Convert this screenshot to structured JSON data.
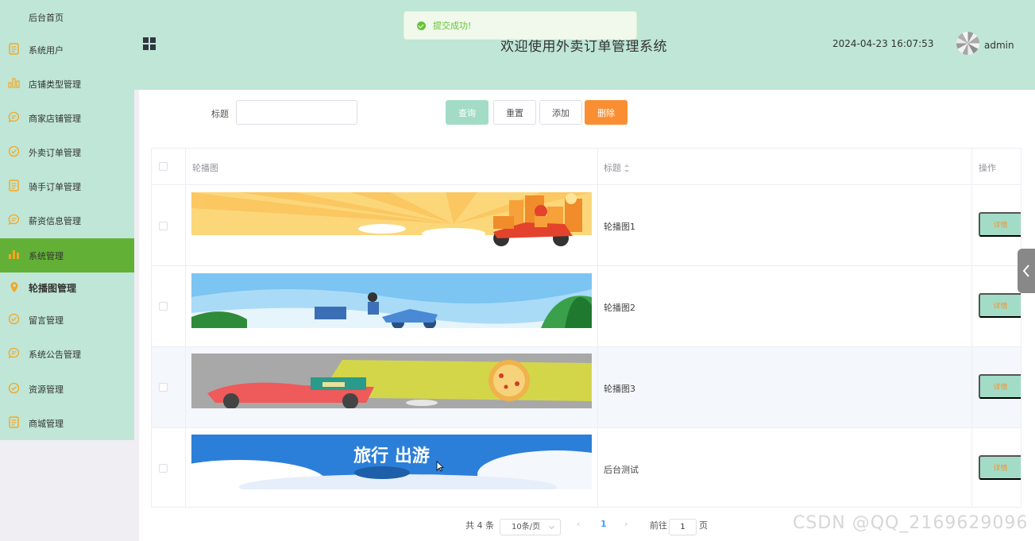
{
  "sidebar": {
    "items": [
      {
        "label": "后台首页",
        "icon": "none"
      },
      {
        "label": "系统用户",
        "icon": "document-icon"
      },
      {
        "label": "店铺类型管理",
        "icon": "bar-chart-icon"
      },
      {
        "label": "商家店铺管理",
        "icon": "chat-bubble-icon"
      },
      {
        "label": "外卖订单管理",
        "icon": "check-circle-icon"
      },
      {
        "label": "骑手订单管理",
        "icon": "document-icon"
      },
      {
        "label": "薪资信息管理",
        "icon": "chat-bubble-icon"
      },
      {
        "label": "系统管理",
        "icon": "bar-chart-icon",
        "active": true
      },
      {
        "label": "轮播图管理",
        "icon": "location-pin-icon",
        "sub": true
      },
      {
        "label": "留言管理",
        "icon": "check-circle-icon"
      },
      {
        "label": "系统公告管理",
        "icon": "chat-bubble-icon"
      },
      {
        "label": "资源管理",
        "icon": "check-circle-icon"
      },
      {
        "label": "商城管理",
        "icon": "document-icon"
      }
    ]
  },
  "header": {
    "title": "欢迎使用外卖订单管理系统",
    "datetime": "2024-04-23 16:07:53",
    "username": "admin"
  },
  "toast": {
    "message": "提交成功!",
    "type": "success"
  },
  "search": {
    "label": "标题",
    "value": "",
    "placeholder": ""
  },
  "toolbar": {
    "query_label": "查询",
    "reset_label": "重置",
    "add_label": "添加",
    "delete_label": "删除"
  },
  "table": {
    "headers": {
      "image": "轮播图",
      "title": "标题",
      "actions": "操作"
    },
    "rows": [
      {
        "title": "轮播图1",
        "action": "详情",
        "image": "delivery-scooter-sunburst"
      },
      {
        "title": "轮播图2",
        "action": "详情",
        "image": "delivery-rider-blue-sky"
      },
      {
        "title": "轮播图3",
        "action": "详情",
        "image": "pizza-scooter"
      },
      {
        "title": "后台测试",
        "action": "详情",
        "image": "travel-clouds"
      }
    ]
  },
  "pagination": {
    "total": "共 4 条",
    "page_size": "10条/页",
    "current_page": "1",
    "goto_label": "前往",
    "goto_value": "1",
    "page_suffix": "页"
  },
  "travel_banner_text": "旅行 出游",
  "watermark": "CSDN @QQ_2169629096",
  "colors": {
    "sidebar_bg": "#bfe6d6",
    "active_nav": "#63b036",
    "icon_orange": "#f5a623",
    "danger": "#f98f32",
    "primary_light": "#a3dcc6"
  }
}
